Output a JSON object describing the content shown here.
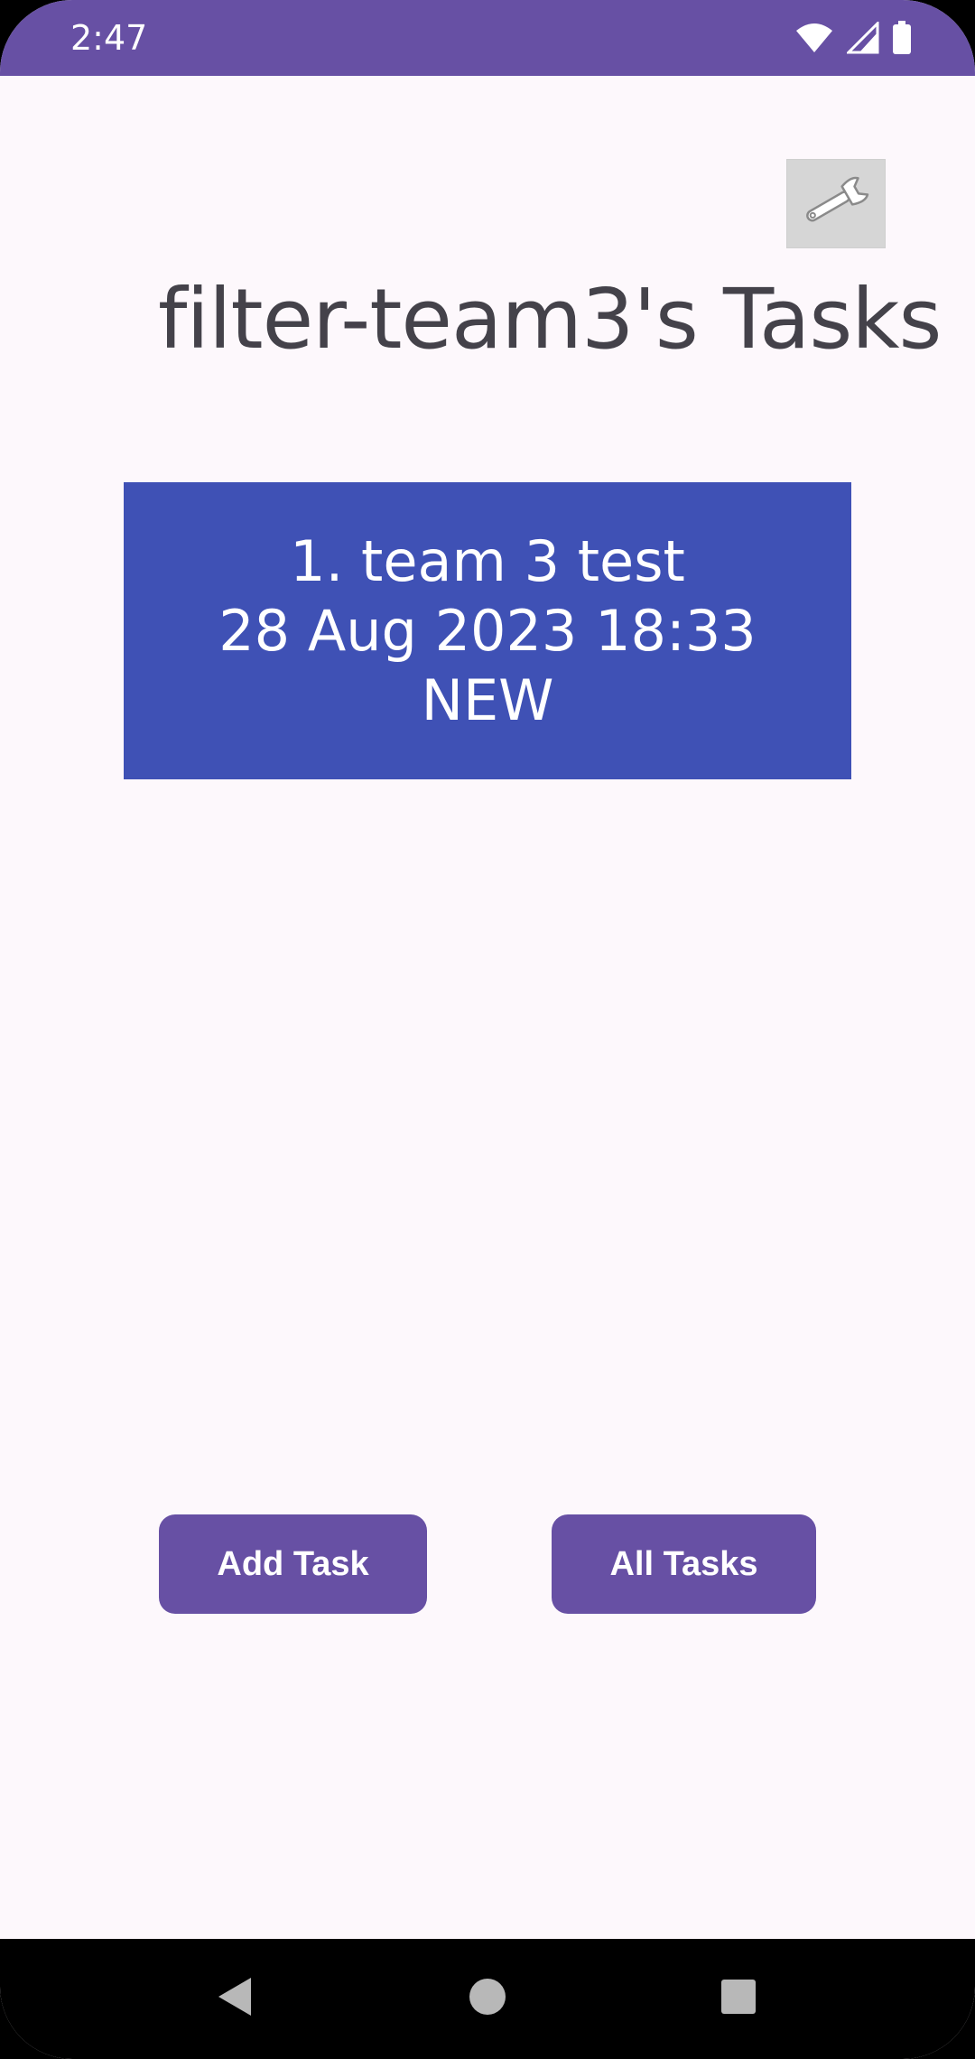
{
  "status_bar": {
    "time": "2:47",
    "icons": [
      "wifi-icon",
      "signal-icon",
      "battery-icon"
    ]
  },
  "toolbar": {
    "settings_icon": "wrench-icon"
  },
  "page": {
    "title": "filter-team3's Tasks"
  },
  "tasks": [
    {
      "title": "1. team 3 test",
      "date": "28 Aug 2023 18:33",
      "status": "NEW"
    }
  ],
  "actions": {
    "add_task_label": "Add Task",
    "all_tasks_label": "All Tasks"
  },
  "navigation": {
    "icons": [
      "back-icon",
      "home-icon",
      "recents-icon"
    ]
  },
  "colors": {
    "primary": "#6750A4",
    "card": "#3F51B5",
    "background": "#FDF8FC",
    "title_text": "#44424A"
  }
}
